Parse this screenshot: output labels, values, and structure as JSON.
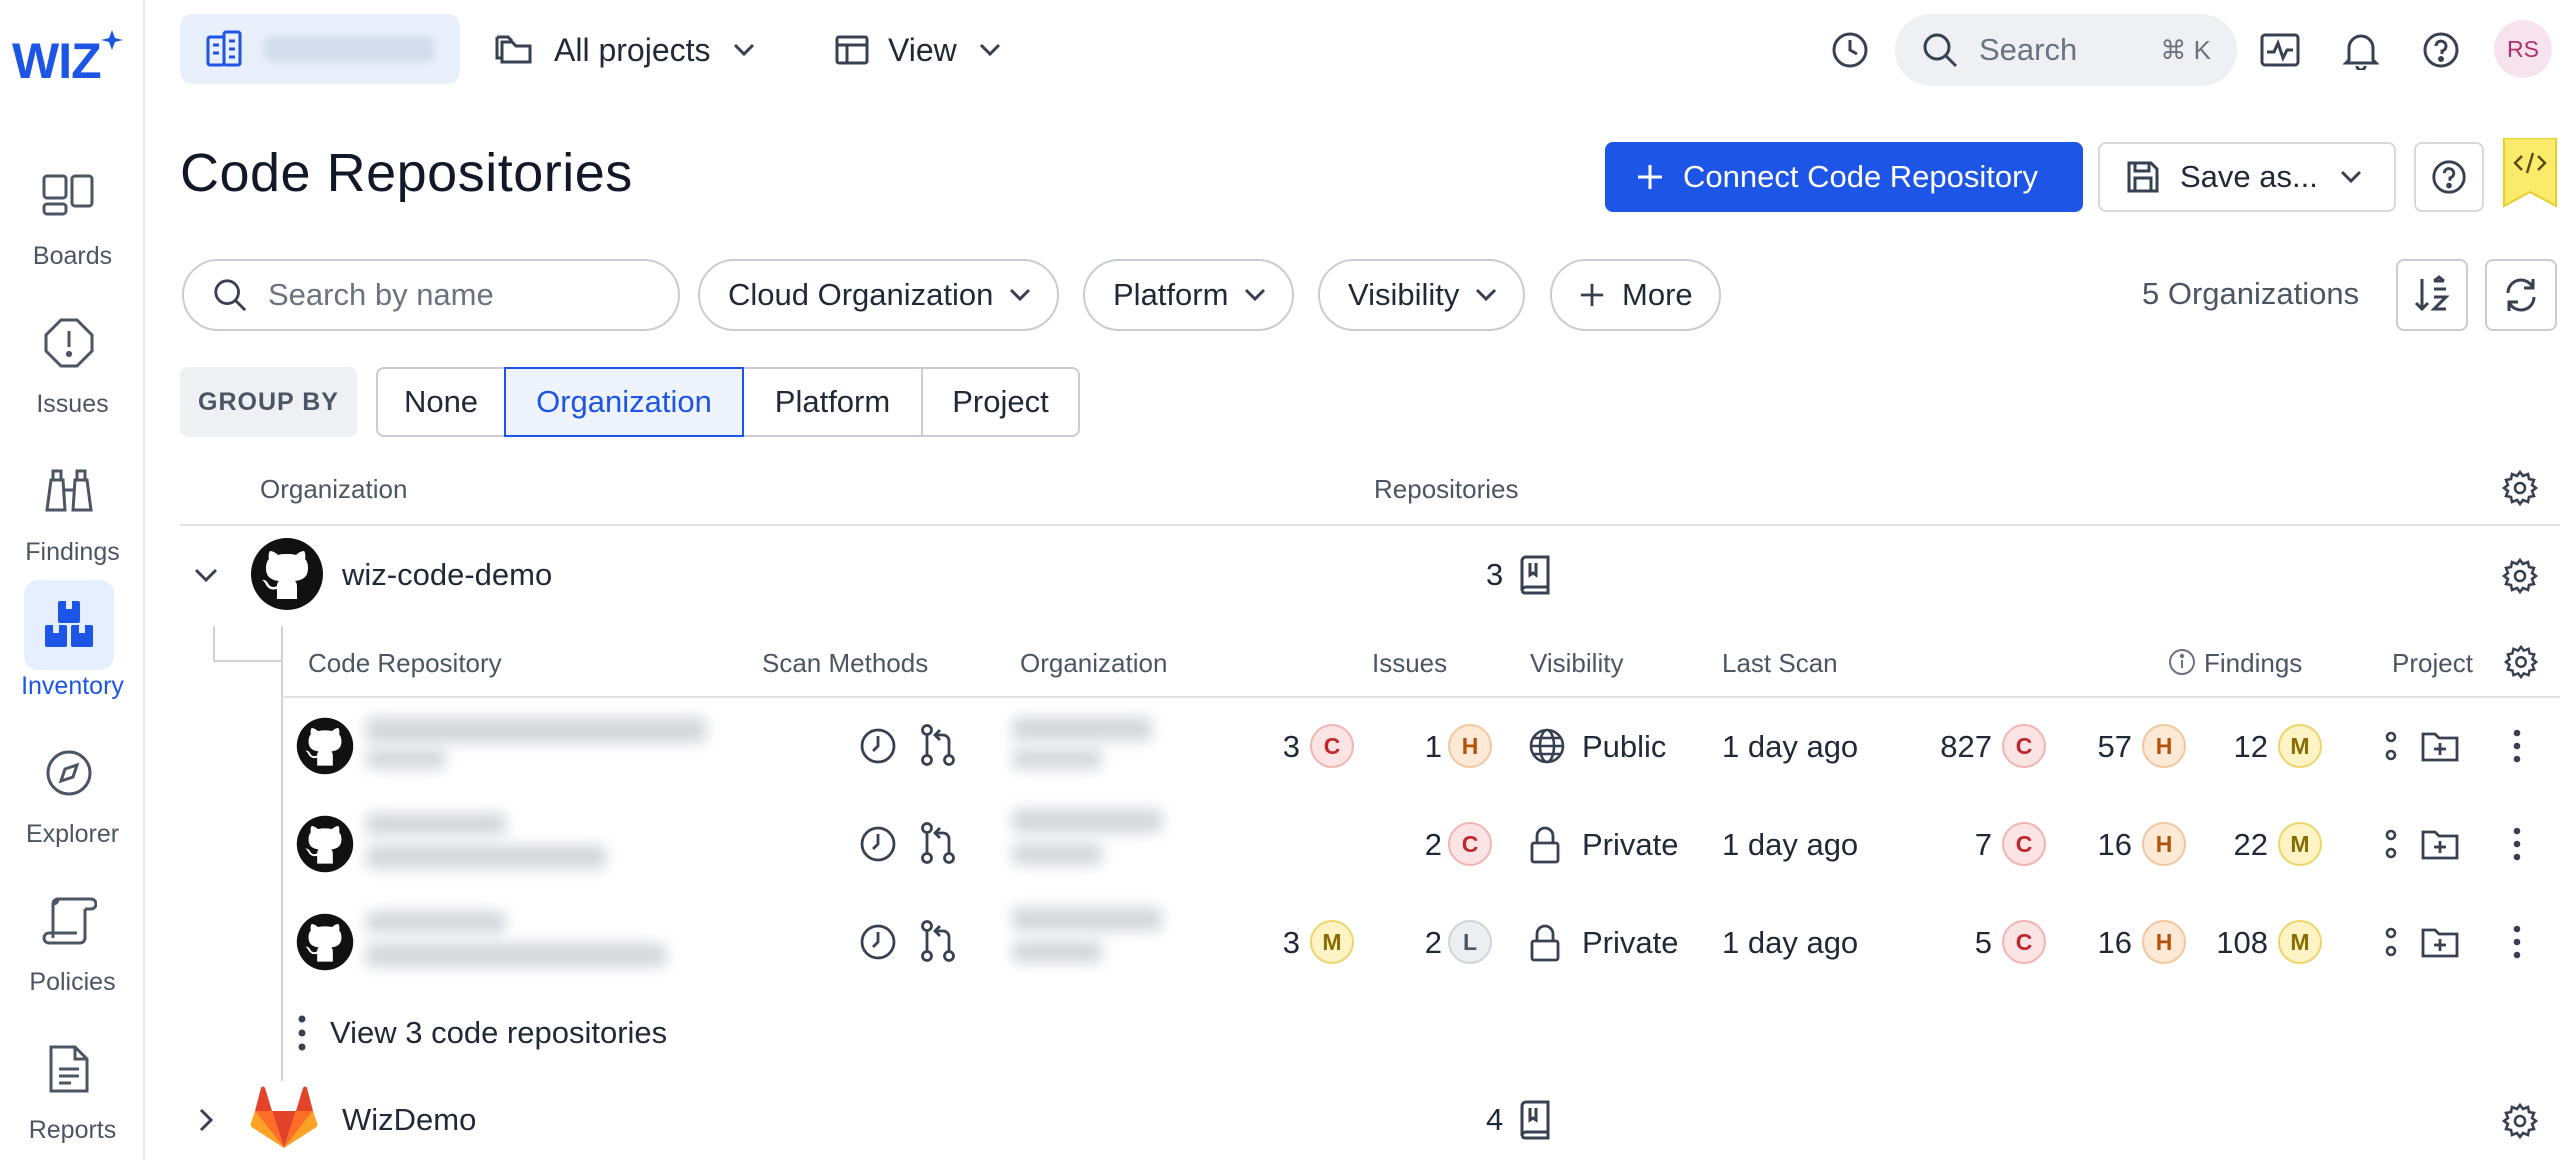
{
  "app": {
    "logo_text": "WIZ",
    "accent": "#1d56e6"
  },
  "sidebar": {
    "items": [
      {
        "label": "Boards",
        "icon": "boards-icon"
      },
      {
        "label": "Issues",
        "icon": "issues-icon"
      },
      {
        "label": "Findings",
        "icon": "findings-icon"
      },
      {
        "label": "Inventory",
        "icon": "inventory-icon",
        "active": true
      },
      {
        "label": "Explorer",
        "icon": "explorer-icon"
      },
      {
        "label": "Policies",
        "icon": "policies-icon"
      },
      {
        "label": "Reports",
        "icon": "reports-icon"
      }
    ]
  },
  "topbar": {
    "projects_label": "All projects",
    "view_label": "View",
    "search_placeholder": "Search",
    "search_shortcut": "⌘ K",
    "avatar_initials": "RS"
  },
  "header": {
    "title": "Code Repositories",
    "connect_label": "Connect Code Repository",
    "save_label": "Save as..."
  },
  "filters": {
    "search_placeholder": "Search by name",
    "chips": [
      "Cloud Organization",
      "Platform",
      "Visibility"
    ],
    "more_label": "More",
    "count_text": "5 Organizations"
  },
  "group_by": {
    "label": "GROUP BY",
    "options": [
      "None",
      "Organization",
      "Platform",
      "Project"
    ],
    "selected": "Organization"
  },
  "table": {
    "col_organization": "Organization",
    "col_repositories": "Repositories",
    "groups": [
      {
        "name": "wiz-code-demo",
        "repo_count": "3",
        "platform": "github",
        "expanded": true
      },
      {
        "name": "WizDemo",
        "repo_count": "4",
        "platform": "gitlab",
        "expanded": false
      }
    ]
  },
  "inner_table": {
    "headers": {
      "repo": "Code Repository",
      "scan": "Scan Methods",
      "org": "Organization",
      "issues": "Issues",
      "visibility": "Visibility",
      "last_scan": "Last Scan",
      "findings": "Findings",
      "project": "Project"
    },
    "rows": [
      {
        "issues_a": {
          "count": "3",
          "sev": "C"
        },
        "issues_b": {
          "count": "1",
          "sev": "H"
        },
        "visibility": "Public",
        "last_scan": "1 day ago",
        "findings": [
          {
            "count": "827",
            "sev": "C"
          },
          {
            "count": "57",
            "sev": "H"
          },
          {
            "count": "12",
            "sev": "M"
          }
        ]
      },
      {
        "issues_a": null,
        "issues_b": {
          "count": "2",
          "sev": "C"
        },
        "visibility": "Private",
        "last_scan": "1 day ago",
        "findings": [
          {
            "count": "7",
            "sev": "C"
          },
          {
            "count": "16",
            "sev": "H"
          },
          {
            "count": "22",
            "sev": "M"
          }
        ]
      },
      {
        "issues_a": {
          "count": "3",
          "sev": "M"
        },
        "issues_b": {
          "count": "2",
          "sev": "L"
        },
        "visibility": "Private",
        "last_scan": "1 day ago",
        "findings": [
          {
            "count": "5",
            "sev": "C"
          },
          {
            "count": "16",
            "sev": "H"
          },
          {
            "count": "108",
            "sev": "M"
          }
        ]
      }
    ],
    "view_more": "View 3 code repositories"
  }
}
